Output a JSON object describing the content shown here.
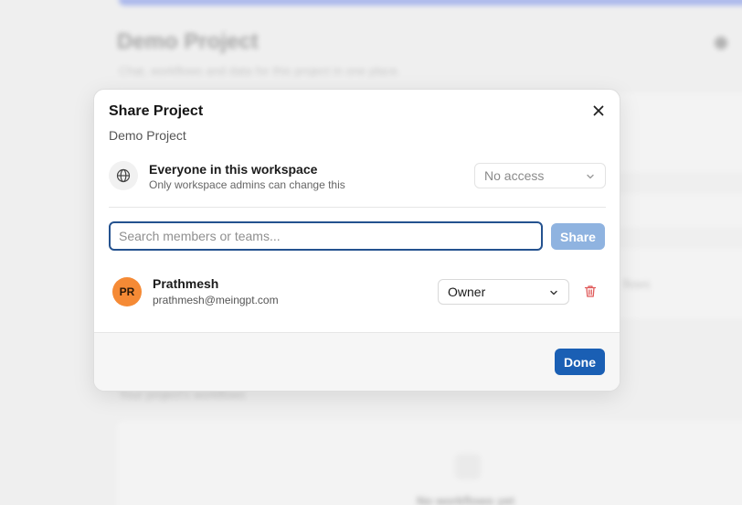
{
  "background": {
    "title": "Demo Project",
    "subtitle": "Chat, workflows and data for this project in one place.",
    "side_text": "flows",
    "section_text": "Your project's workflows",
    "empty_text": "No workflows yet"
  },
  "modal": {
    "title": "Share Project",
    "subtitle": "Demo Project",
    "workspace": {
      "icon": "globe-icon",
      "name": "Everyone in this workspace",
      "note": "Only workspace admins can change this",
      "access_value": "No access"
    },
    "search": {
      "placeholder": "Search members or teams...",
      "value": ""
    },
    "share_label": "Share",
    "members": [
      {
        "initials": "PR",
        "name": "Prathmesh",
        "email": "prathmesh@meingpt.com",
        "role": "Owner",
        "avatar_color": "#f58a35"
      }
    ],
    "done_label": "Done"
  },
  "colors": {
    "primary": "#1a5fb4",
    "share_disabled": "#8fb3e0",
    "delete": "#e05a5a"
  }
}
